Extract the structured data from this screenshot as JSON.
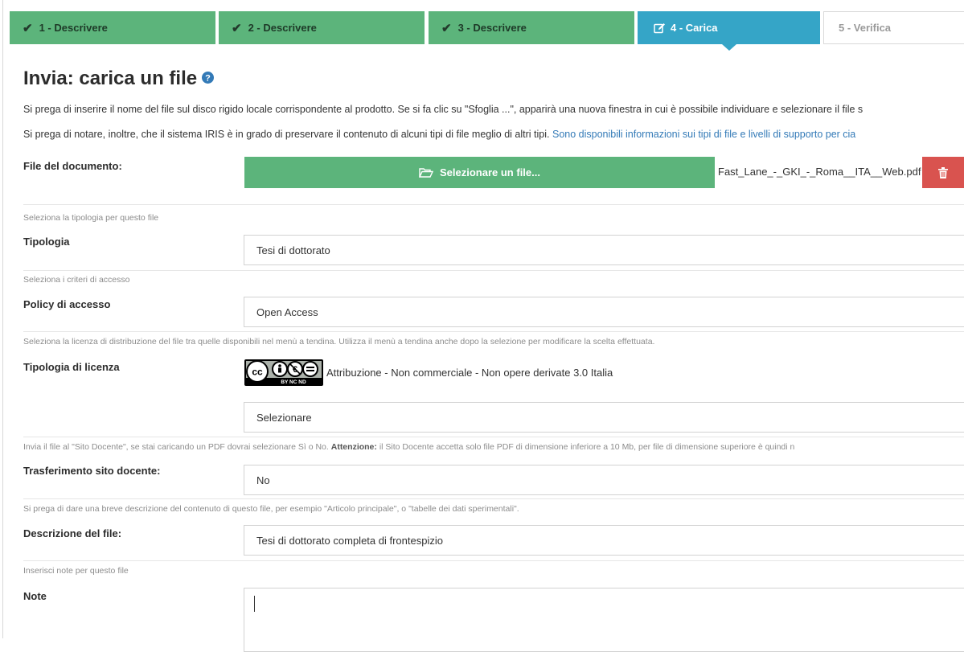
{
  "steps": [
    {
      "label": "1 - Descrivere",
      "state": "done"
    },
    {
      "label": "2 - Descrivere",
      "state": "done"
    },
    {
      "label": "3 - Descrivere",
      "state": "done"
    },
    {
      "label": "4 - Carica",
      "state": "active"
    },
    {
      "label": "5 - Verifica",
      "state": "pending"
    }
  ],
  "page": {
    "title": "Invia: carica un file",
    "intro_1": "Si prega di inserire il nome del file sul disco rigido locale corrispondente al prodotto. Se si fa clic su \"Sfoglia ...\", apparirà una nuova finestra in cui è possibile individuare e selezionare il file s",
    "intro_2": "Si prega di notare, inoltre, che il sistema IRIS è in grado di preservare il contenuto di alcuni tipi di file meglio di altri tipi.",
    "intro_2_link": "Sono disponibili informazioni sui tipi di file e livelli di supporto per cia"
  },
  "file": {
    "label": "File del documento:",
    "button_label": "Selezionare un file...",
    "filename": "Fast_Lane_-_GKI_-_Roma__ITA__Web.pdf"
  },
  "tipologia": {
    "hint": "Seleziona la tipologia per questo file",
    "label": "Tipologia",
    "value": "Tesi di dottorato"
  },
  "policy": {
    "hint": "Seleziona i criteri di accesso",
    "label": "Policy di accesso",
    "value": "Open Access"
  },
  "licenza": {
    "hint": "Seleziona la licenza di distribuzione del file tra quelle disponibili nel menù a tendina. Utilizza il menù a tendina anche dopo la selezione per modificare la scelta effettuata.",
    "label": "Tipologia di licenza",
    "badge_text": "BY NC ND",
    "license_name": "Attribuzione - Non commerciale - Non opere derivate 3.0 Italia",
    "select_value": "Selezionare"
  },
  "sito": {
    "hint_a": "Invia il file al \"Sito Docente\", se stai caricando un PDF dovrai selezionare Sì o No.",
    "hint_bold": "Attenzione:",
    "hint_b": "il Sito Docente accetta solo file PDF di dimensione inferiore a 10 Mb, per file di dimensione superiore è quindi n",
    "label": "Trasferimento sito docente:",
    "value": "No"
  },
  "descrizione": {
    "hint": "Si prega di dare una breve descrizione del contenuto di questo file, per esempio \"Articolo principale\", o \"tabelle dei dati sperimentali\".",
    "label": "Descrizione del file:",
    "value": "Tesi di dottorato completa di frontespizio"
  },
  "note": {
    "hint": "Inserisci note per questo file",
    "label": "Note",
    "value": ""
  },
  "colors": {
    "step_done": "#5cb47b",
    "step_active": "#35a5c7",
    "button_green": "#5cb47b",
    "delete_red": "#d9534f",
    "link": "#337ab7"
  },
  "icons": {
    "step_done": "check-icon",
    "step_active": "edit-icon",
    "title": "question-circle-icon",
    "upload": "folder-open-icon",
    "delete": "trash-icon",
    "license": "creative-commons-badge"
  }
}
